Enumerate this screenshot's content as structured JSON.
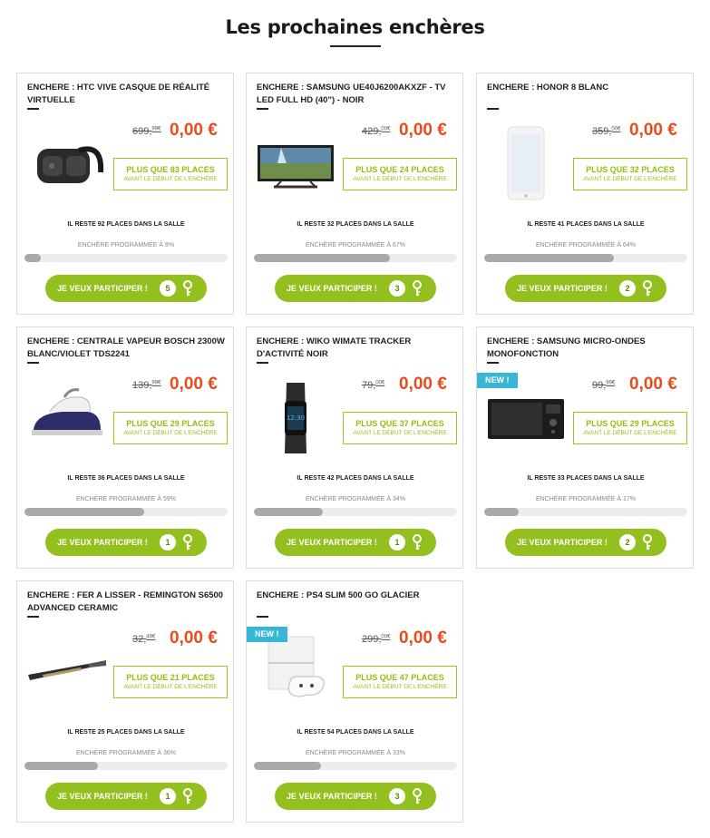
{
  "page": {
    "title": "Les prochaines enchères"
  },
  "labels": {
    "places_sub": "AVANT LE DÉBUT DE L'ENCHÈRE",
    "participate": "JE VEUX PARTICIPER !",
    "new_badge": "NEW !"
  },
  "colors": {
    "accent_green": "#93c01f",
    "price_red": "#e84c1e",
    "badge_blue": "#37b7d6"
  },
  "auctions": [
    {
      "title": "ENCHERE : HTC VIVE CASQUE DE RÉALITÉ VIRTUELLE",
      "image": "vr-headset",
      "is_new": false,
      "old_price_int": "699,",
      "old_price_dec": "99",
      "old_price_cur": "€",
      "price": "0,00 €",
      "places_main": "PLUS QUE 83 PLACES",
      "remaining": "IL RESTE 92 PLACES DANS LA SALLE",
      "programmed": "ENCHÈRE PROGRAMMÉE À 8%",
      "progress": 8,
      "count": "5"
    },
    {
      "title": "ENCHERE : SAMSUNG UE40J6200AKXZF - TV LED FULL HD (40\") - NOIR",
      "image": "tv",
      "is_new": false,
      "old_price_int": "429,",
      "old_price_dec": "00",
      "old_price_cur": "€",
      "price": "0,00 €",
      "places_main": "PLUS QUE 24 PLACES",
      "remaining": "IL RESTE 32 PLACES DANS LA SALLE",
      "programmed": "ENCHÈRE PROGRAMMÉE À 67%",
      "progress": 67,
      "count": "3"
    },
    {
      "title": "ENCHERE : HONOR 8 BLANC",
      "image": "phone",
      "is_new": false,
      "old_price_int": "359,",
      "old_price_dec": "00",
      "old_price_cur": "€",
      "price": "0,00 €",
      "places_main": "PLUS QUE 32 PLACES",
      "remaining": "IL RESTE 41 PLACES DANS LA SALLE",
      "programmed": "ENCHÈRE PROGRAMMÉE À 64%",
      "progress": 64,
      "count": "2"
    },
    {
      "title": "ENCHERE : CENTRALE VAPEUR BOSCH 2300W BLANC/VIOLET TDS2241",
      "image": "iron",
      "is_new": false,
      "old_price_int": "139,",
      "old_price_dec": "99",
      "old_price_cur": "€",
      "price": "0,00 €",
      "places_main": "PLUS QUE 29 PLACES",
      "remaining": "IL RESTE 36 PLACES DANS LA SALLE",
      "programmed": "ENCHÈRE PROGRAMMÉE À 59%",
      "progress": 59,
      "count": "1"
    },
    {
      "title": "ENCHERE : WIKO WIMATE TRACKER D'ACTIVITÉ NOIR",
      "image": "tracker",
      "is_new": false,
      "old_price_int": "79,",
      "old_price_dec": "00",
      "old_price_cur": "€",
      "price": "0,00 €",
      "places_main": "PLUS QUE 37 PLACES",
      "remaining": "IL RESTE 42 PLACES DANS LA SALLE",
      "programmed": "ENCHÈRE PROGRAMMÉE À 34%",
      "progress": 34,
      "count": "1"
    },
    {
      "title": "ENCHERE : SAMSUNG MICRO-ONDES MONOFONCTION",
      "image": "microwave",
      "is_new": true,
      "old_price_int": "99,",
      "old_price_dec": "99",
      "old_price_cur": "€",
      "price": "0,00 €",
      "places_main": "PLUS QUE 29 PLACES",
      "remaining": "IL RESTE 33 PLACES DANS LA SALLE",
      "programmed": "ENCHÈRE PROGRAMMÉE À 17%",
      "progress": 17,
      "count": "2"
    },
    {
      "title": "ENCHERE : FER A LISSER - REMINGTON S6500 ADVANCED CERAMIC",
      "image": "straightener",
      "is_new": false,
      "old_price_int": "32,",
      "old_price_dec": "49",
      "old_price_cur": "€",
      "price": "0,00 €",
      "places_main": "PLUS QUE 21 PLACES",
      "remaining": "IL RESTE 25 PLACES DANS LA SALLE",
      "programmed": "ENCHÈRE PROGRAMMÉE À 36%",
      "progress": 36,
      "count": "1"
    },
    {
      "title": "ENCHERE : PS4 SLIM 500 GO GLACIER",
      "image": "console",
      "is_new": true,
      "old_price_int": "299,",
      "old_price_dec": "00",
      "old_price_cur": "€",
      "price": "0,00 €",
      "places_main": "PLUS QUE 47 PLACES",
      "remaining": "IL RESTE 54 PLACES DANS LA SALLE",
      "programmed": "ENCHÈRE PROGRAMMÉE À 33%",
      "progress": 33,
      "count": "3"
    }
  ]
}
